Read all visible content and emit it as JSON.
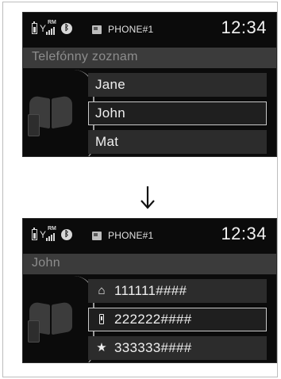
{
  "colors": {
    "screen_bg": "#0b0b0b",
    "title_bar_bg": "#3b3b3b",
    "row_bg": "#2c2c2c",
    "selection_border": "#c8c8c8",
    "text": "#efefef"
  },
  "screens": [
    {
      "status": {
        "roaming": "RM",
        "bluetooth_icon": "bluetooth-icon",
        "phone_label": "PHONE#1",
        "clock": "12:34"
      },
      "title": "Telefónny zoznam",
      "rows": [
        {
          "label": "Jane",
          "selected": false
        },
        {
          "label": "John",
          "selected": true
        },
        {
          "label": "Mat",
          "selected": false
        }
      ]
    },
    {
      "status": {
        "roaming": "RM",
        "bluetooth_icon": "bluetooth-icon",
        "phone_label": "PHONE#1",
        "clock": "12:34"
      },
      "title": "John",
      "rows": [
        {
          "icon": "home-icon",
          "label": "111111####",
          "selected": false
        },
        {
          "icon": "mobile-phone-icon",
          "label": "222222####",
          "selected": true
        },
        {
          "icon": "star-icon",
          "label": "333333####",
          "selected": false
        }
      ]
    }
  ],
  "transition_icon": "down-arrow-icon"
}
